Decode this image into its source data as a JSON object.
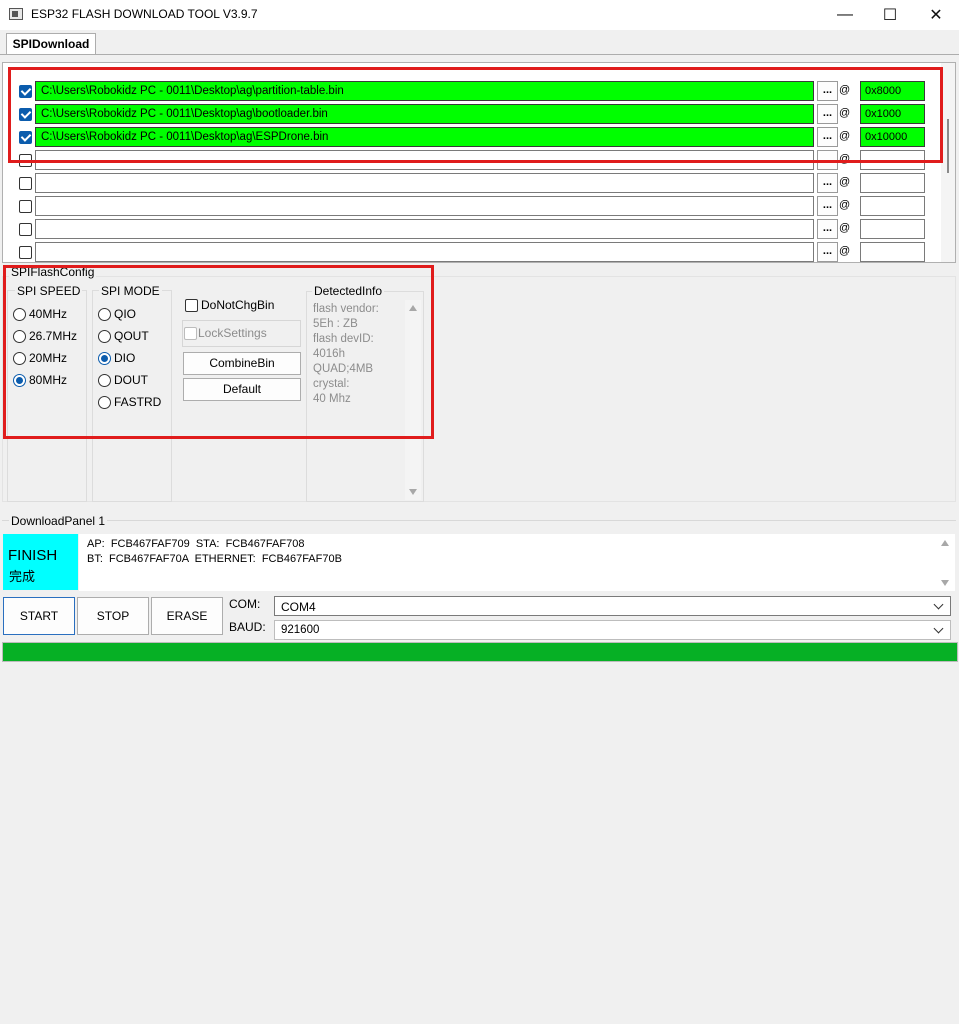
{
  "window": {
    "title": "ESP32 FLASH DOWNLOAD TOOL V3.9.7",
    "minimize_glyph": "—",
    "maximize_glyph": "☐",
    "close_glyph": "✕"
  },
  "tabs": [
    {
      "label": "SPIDownload",
      "active": true
    }
  ],
  "files": [
    {
      "checked": true,
      "path": "C:\\Users\\Robokidz PC - 0011\\Desktop\\ag\\partition-table.bin",
      "address": "0x8000"
    },
    {
      "checked": true,
      "path": "C:\\Users\\Robokidz PC - 0011\\Desktop\\ag\\bootloader.bin",
      "address": "0x1000"
    },
    {
      "checked": true,
      "path": "C:\\Users\\Robokidz PC - 0011\\Desktop\\ag\\ESPDrone.bin",
      "address": "0x10000"
    },
    {
      "checked": false,
      "path": "",
      "address": ""
    },
    {
      "checked": false,
      "path": "",
      "address": ""
    },
    {
      "checked": false,
      "path": "",
      "address": ""
    },
    {
      "checked": false,
      "path": "",
      "address": ""
    },
    {
      "checked": false,
      "path": "",
      "address": ""
    }
  ],
  "file_row": {
    "browse_label": "...",
    "at_label": "@"
  },
  "spi_flash_config": {
    "title": "SPIFlashConfig",
    "spi_speed": {
      "title": "SPI SPEED",
      "options": [
        "40MHz",
        "26.7MHz",
        "20MHz",
        "80MHz"
      ],
      "selected": "80MHz"
    },
    "spi_mode": {
      "title": "SPI MODE",
      "options": [
        "QIO",
        "QOUT",
        "DIO",
        "DOUT",
        "FASTRD"
      ],
      "selected": "DIO"
    },
    "do_not_chg_bin": {
      "label": "DoNotChgBin",
      "checked": false
    },
    "lock_settings": {
      "label": "LockSettings",
      "checked": false,
      "enabled": false
    },
    "combine_bin_label": "CombineBin",
    "default_label": "Default",
    "detected_info": {
      "title": "DetectedInfo",
      "lines": [
        "flash vendor:",
        "5Eh : ZB",
        "flash devID:",
        "4016h",
        "QUAD;4MB",
        "crystal:",
        "40 Mhz"
      ]
    }
  },
  "download_panel": {
    "title": "DownloadPanel 1",
    "status": "FINISH",
    "status_cn": "完成",
    "status_color": "#00ffff",
    "log_lines": [
      "AP:  FCB467FAF709  STA:  FCB467FAF708",
      "BT:  FCB467FAF70A  ETHERNET:  FCB467FAF70B"
    ],
    "start_label": "START",
    "stop_label": "STOP",
    "erase_label": "ERASE",
    "com_label": "COM:",
    "com_value": "COM4",
    "baud_label": "BAUD:",
    "baud_value": "921600",
    "progress": 1.0,
    "progress_color": "#06b025"
  },
  "colors": {
    "highlight_red": "#e01c1c",
    "file_filled": "#00ff00",
    "accent_blue": "#0b5cad"
  }
}
